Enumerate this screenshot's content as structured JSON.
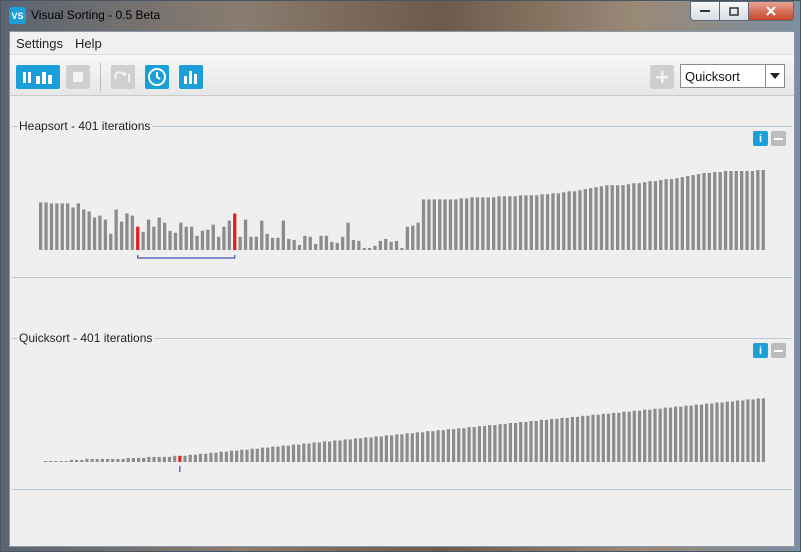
{
  "window": {
    "title": "Visual Sorting - 0.5 Beta",
    "icon_text": "VS"
  },
  "menu": {
    "items": [
      "Settings",
      "Help"
    ]
  },
  "toolbar": {
    "algorithm_select": "Quicksort"
  },
  "panels": [
    {
      "title": "Heapsort - 401 iterations",
      "info_label": "i"
    },
    {
      "title": "Quicksort - 401 iterations",
      "info_label": "i"
    }
  ],
  "colors": {
    "accent": "#1a9fd8",
    "bar": "#8c8c8c",
    "highlight": "#e02020",
    "bracket": "#1a2aa0"
  },
  "heapsort_bars": {
    "values": [
      47,
      47,
      46,
      46,
      46,
      46,
      42,
      46,
      40,
      38,
      32,
      34,
      30,
      16,
      40,
      28,
      36,
      34,
      23,
      18,
      30,
      23,
      32,
      27,
      19,
      17,
      27,
      23,
      23,
      14,
      19,
      20,
      25,
      13,
      23,
      29,
      36,
      13,
      30,
      13,
      13,
      29,
      16,
      12,
      12,
      29,
      11,
      10,
      5,
      14,
      13,
      6,
      14,
      14,
      8,
      7,
      13,
      27,
      10,
      9,
      2,
      2,
      4,
      9,
      11,
      8,
      9,
      2,
      23,
      24,
      27,
      50,
      50,
      50,
      50,
      50,
      50,
      50,
      51,
      51,
      52,
      52,
      52,
      52,
      52,
      53,
      53,
      53,
      53,
      54,
      54,
      54,
      54,
      55,
      55,
      56,
      56,
      57,
      58,
      58,
      59,
      60,
      61,
      62,
      63,
      64,
      64,
      64,
      64,
      65,
      66,
      66,
      67,
      68,
      68,
      69,
      70,
      70,
      71,
      72,
      73,
      74,
      75,
      76,
      76,
      77,
      77,
      78,
      78,
      78,
      78,
      78,
      78,
      79,
      79
    ],
    "highlighted": [
      18,
      36
    ],
    "max": 79
  },
  "quicksort_bars": {
    "values": [
      1,
      1,
      1,
      1,
      1,
      2,
      2,
      2,
      3,
      3,
      3,
      3,
      3,
      3,
      3,
      3,
      4,
      4,
      4,
      4,
      5,
      5,
      5,
      5,
      5,
      6,
      6,
      6,
      7,
      7,
      8,
      8,
      9,
      9,
      10,
      10,
      11,
      11,
      12,
      12,
      13,
      13,
      14,
      14,
      15,
      15,
      16,
      16,
      17,
      17,
      18,
      18,
      19,
      19,
      20,
      20,
      21,
      21,
      22,
      22,
      23,
      23,
      24,
      24,
      25,
      25,
      26,
      26,
      27,
      27,
      28,
      28,
      29,
      29,
      30,
      30,
      31,
      31,
      32,
      32,
      33,
      33,
      34,
      34,
      35,
      35,
      36,
      36,
      37,
      37,
      38,
      38,
      39,
      39,
      40,
      40,
      41,
      41,
      42,
      42,
      43,
      43,
      44,
      44,
      45,
      45,
      46,
      46,
      47,
      47,
      48,
      48,
      49,
      49,
      50,
      50,
      51,
      51,
      52,
      52,
      53,
      53,
      54,
      54,
      55,
      55,
      56,
      56,
      57,
      57,
      58,
      58,
      59,
      59,
      60,
      60,
      61,
      61,
      62,
      62
    ],
    "highlighted": [
      26
    ],
    "max": 78
  }
}
